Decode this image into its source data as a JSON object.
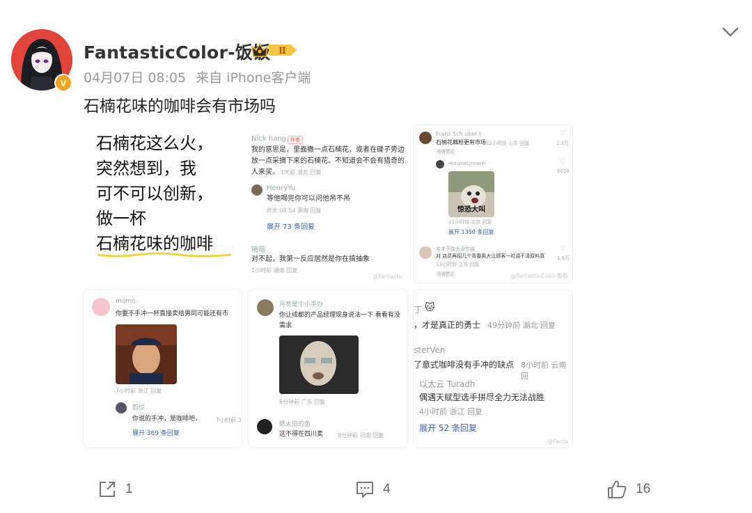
{
  "post": {
    "username": "FantasticColor-饭饭",
    "rank_badge": "Ⅱ",
    "verified_badge": "V",
    "date": "04月07日 08:05",
    "source": "来自 iPhone客户端",
    "text": "石楠花味的咖啡会有市场吗"
  },
  "images": {
    "tile1": {
      "lines": [
        "石楠花这么火，",
        "突然想到，我",
        "可不可以创新，",
        "做一杯"
      ],
      "highlight": "石楠花味的咖啡"
    },
    "tile2": {
      "name1": "Nick hang",
      "author_tag": "作者",
      "text1a": "我的意思是，里面撒一点石楠花，或者在碟子旁边",
      "text1b": "放一点采摘下来的石楠花。不知道会不会有猎奇的",
      "text1c": "人来买。",
      "sub1": "1天前 湖北 回复",
      "name2": "HenryYu",
      "text2": "等他喝完你可以问他吊不吊",
      "sub2": "昨天 08:54 湖南 回复",
      "link2": "展开 73 条回复",
      "name3": "晦暗",
      "text3": "对不起，我第一反应居然是你在搞抽象",
      "sub3": "1小时前 湖南 回复",
      "watermark": "@Fantastic"
    },
    "tile3": {
      "name1": "Franz Sch uber t",
      "text1": "石楠花藕粉更有市场",
      "sub1": "12小时前 山东 回复",
      "likes1": "1.3万",
      "tag": "作者赞过",
      "name2": "HorizonUnravel",
      "likes2": "6029",
      "meme_caption": "惊恐大叫",
      "sub2": "12小时前 北京 回复",
      "link2": "展开 1350 条回复",
      "name3": "名字不能太没节操",
      "text3": "对 店员再招几个青春男大让顾客一时调不清原料真",
      "sub3": "13小时前 江苏 回复",
      "likes3": "1.6万",
      "tag3": "作者赞过",
      "watermark": "@FantasticColor-饭饭"
    },
    "tile4": {
      "name1": "momo",
      "text1": "你要不手冲一杯直接卖给男同可能还有市",
      "sub1": "7小时前 浙江 回复",
      "name2": "韵纹",
      "text2": "你说的手冲，是咖啡吧，",
      "sub2": "7小时前 3",
      "link2": "展开 369 条回复"
    },
    "tile5": {
      "name1": "月亮是个小手办",
      "text1a": "你让成都的产品经理现身说法一下 看看有没",
      "text1b": "需求",
      "sub1": "6分钟前 广东 回复",
      "name2": "晒太阳的鱼",
      "text2": "这不得在四川卖",
      "sub2": "8分钟前 河南 回复"
    },
    "tile6": {
      "name1": "丁",
      "text1": "，才是真正的勇士",
      "sub1": "49分钟前 湖北 回复",
      "name2": "sterVen",
      "text2": "了意式咖啡没有手冲的缺点",
      "sub2": "8小时前 云南 回",
      "name3": "以太云 Turadh",
      "text3": "偶遇天赋型选手拼尽全力无法战胜",
      "sub3": "4小时前 浙江 回复",
      "link3": "展开 52 条回复",
      "watermark": "@Fanta"
    }
  },
  "actions": {
    "share_count": "1",
    "comment_count": "4",
    "like_count": "16"
  },
  "colors": {
    "link": "#3b5fa5",
    "meta": "#999999",
    "avatar_bg": "#e0443a",
    "verified": "#f4a51c"
  }
}
